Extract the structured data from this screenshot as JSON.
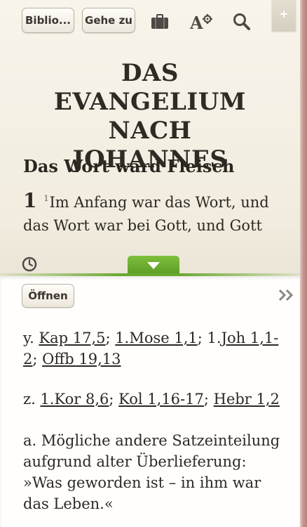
{
  "toolbar": {
    "library_label": "Biblio...",
    "goto_label": "Gehe zu",
    "add_label": "+"
  },
  "reader": {
    "book_title": "DAS EVANGELIUM NACH JOHANNES",
    "section_heading": "Das Wort ward Fleisch",
    "chapter": "1",
    "verse_number": "1",
    "verse_text": "Im Anfang war das Wort, und das Wort war bei Gott, und Gott"
  },
  "notes_panel": {
    "open_label": "Öffnen",
    "note_y": {
      "marker": "y.",
      "refs": [
        "Kap 17,5",
        "1.Mose 1,1",
        "Joh 1,1-2",
        "Offb 19,13"
      ],
      "sep": "; ",
      "mid_prefix": "1."
    },
    "note_z": {
      "marker": "z.",
      "refs": [
        "1.Kor 8,6",
        "Kol 1,16-17",
        "Hebr 1,2"
      ],
      "sep": "; "
    },
    "note_a": "a. Mögliche andere Satzeinteilung aufgrund alter Überlieferung: »Was geworden ist – in ihm war das Leben.«"
  },
  "colors": {
    "accent_green": "#6aa830",
    "page_bg": "#f3eee2",
    "text": "#2d2822"
  }
}
